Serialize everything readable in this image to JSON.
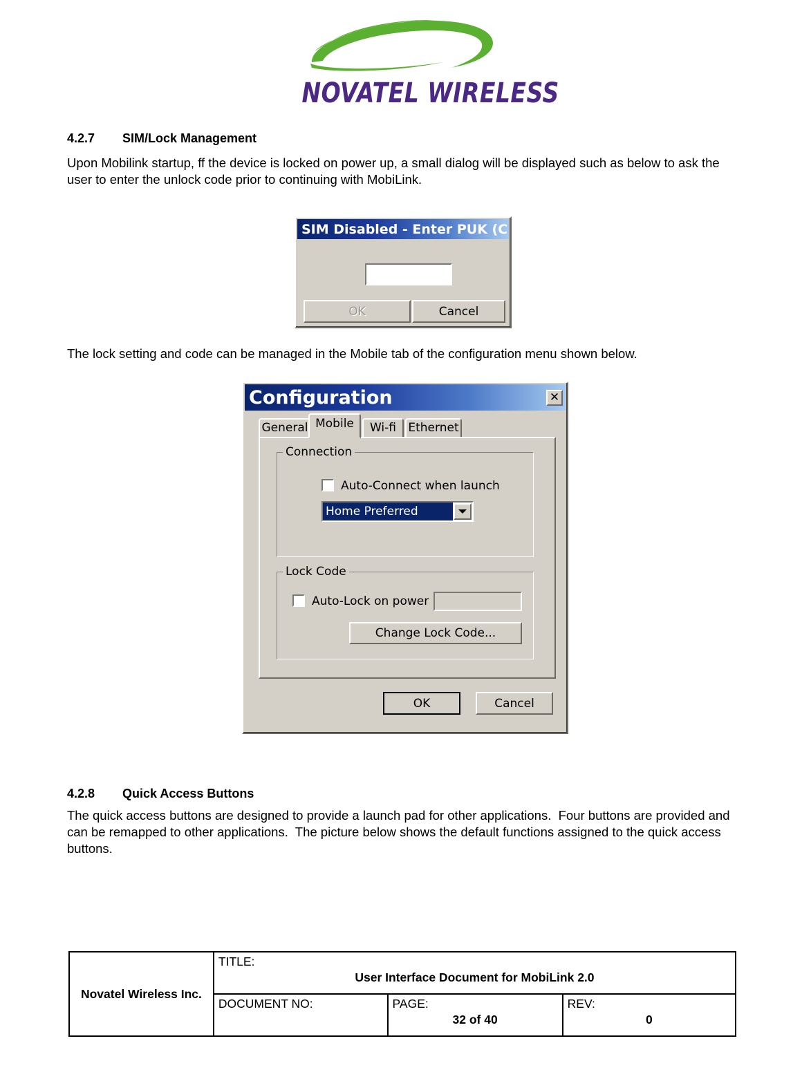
{
  "logo": {
    "wordmark": "NOVATEL WIRELESS",
    "green": "#5CB031",
    "purple": "#4B2884"
  },
  "sections": {
    "s427": {
      "number": "4.2.7",
      "title": "SIM/Lock Management",
      "paragraph": "Upon Mobilink startup, ff the device is locked on power up, a small dialog will be displayed such as below to ask the user to enter the unlock code prior to continuing with MobiLink."
    },
    "caption": "The lock setting and code can be managed in the Mobile tab of the configuration menu shown below.",
    "s428": {
      "number": "4.2.8",
      "title": "Quick Access Buttons",
      "paragraph": "The quick access buttons are designed to provide a launch pad for other applications.  Four buttons are provided and can be remapped to other applications.  The picture below shows the default functions assigned to the quick access buttons."
    }
  },
  "sim_dialog": {
    "title": "SIM Disabled - Enter PUK (C...",
    "input_value": "",
    "ok_label": "OK",
    "cancel_label": "Cancel"
  },
  "config_dialog": {
    "title": "Configuration",
    "close_label": "✕",
    "tabs": [
      {
        "label": "General",
        "selected": false
      },
      {
        "label": "Mobile",
        "selected": true
      },
      {
        "label": "Wi-fi",
        "selected": false
      },
      {
        "label": "Ethernet",
        "selected": false
      }
    ],
    "connection_group": {
      "title": "Connection",
      "autoconnect_label": "Auto-Connect when launch",
      "autoconnect_checked": false,
      "mode_value": "Home Preferred"
    },
    "lockcode_group": {
      "title": "Lock Code",
      "autolock_label": "Auto-Lock on power up",
      "autolock_checked": false,
      "code_value": "",
      "change_label": "Change Lock Code..."
    },
    "ok_label": "OK",
    "cancel_label": "Cancel"
  },
  "footer": {
    "company": "Novatel Wireless Inc.",
    "title_label": "TITLE:",
    "title_value": "User Interface Document for MobiLink 2.0",
    "docno_label": "DOCUMENT NO:",
    "docno_value": "",
    "page_label": "PAGE:",
    "page_value": "32 of 40",
    "rev_label": "REV:",
    "rev_value": "0"
  }
}
